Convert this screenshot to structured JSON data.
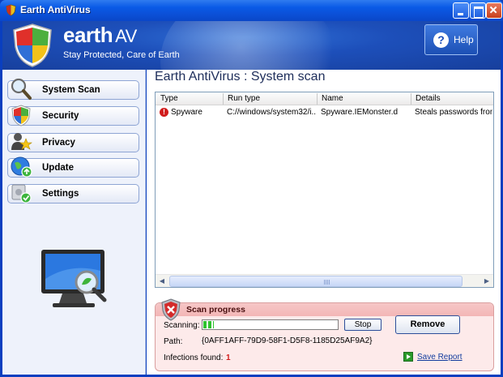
{
  "window": {
    "title": "Earth AntiVirus"
  },
  "banner": {
    "brand": "earth",
    "brand_suffix": "AV",
    "tagline": "Stay Protected, Care of Earth",
    "help_label": "Help"
  },
  "nav": {
    "items": [
      {
        "label": "System Scan",
        "icon": "magnifier-icon"
      },
      {
        "label": "Security",
        "icon": "shield-icon"
      },
      {
        "label": "Privacy",
        "icon": "user-star-icon"
      },
      {
        "label": "Update",
        "icon": "globe-update-icon"
      },
      {
        "label": "Settings",
        "icon": "gear-check-icon"
      }
    ]
  },
  "main": {
    "title": "Earth AntiVirus :  System  scan",
    "table": {
      "columns": [
        "Type",
        "Run type",
        "Name",
        "Details"
      ],
      "rows": [
        {
          "type": "Spyware",
          "run_type": "C://windows/system32/i...",
          "name": "Spyware.IEMonster.d",
          "details": "Steals passwords from I"
        }
      ]
    }
  },
  "progress": {
    "title": "Scan progress",
    "scanning_label": "Scanning:",
    "progress_fraction": 0.08,
    "stop_label": "Stop",
    "remove_label": "Remove",
    "path_label": "Path:",
    "path_value": "{0AFF1AFF-79D9-58F1-D5F8-1185D25AF9A2}",
    "infections_label": "Infections found:",
    "infections_count": "1",
    "save_report_label": "Save  Report"
  },
  "colors": {
    "accent": "#1d4fba",
    "alert": "#d11c1c",
    "progress": "#2fc22f"
  }
}
